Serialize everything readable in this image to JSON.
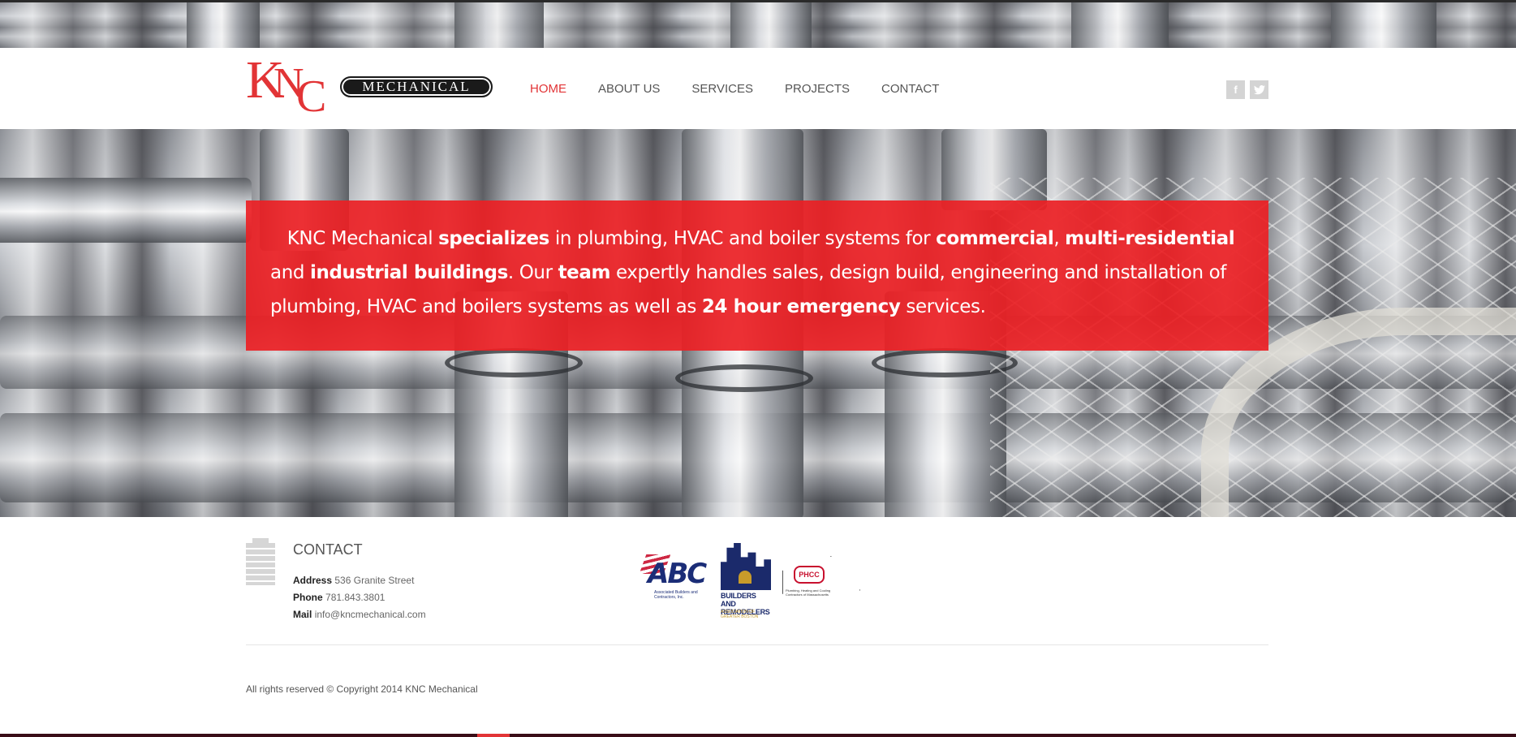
{
  "brand": {
    "logo_letters": [
      "K",
      "N",
      "C"
    ],
    "logo_word": "MECHANICAL",
    "accent_color": "#e23436"
  },
  "nav": {
    "items": [
      {
        "label": "HOME",
        "active": true
      },
      {
        "label": "ABOUT US",
        "active": false
      },
      {
        "label": "SERVICES",
        "active": false
      },
      {
        "label": "PROJECTS",
        "active": false
      },
      {
        "label": "CONTACT",
        "active": false
      }
    ]
  },
  "social": {
    "facebook": "f",
    "twitter": "t",
    "icons": [
      "facebook-icon",
      "twitter-icon"
    ]
  },
  "banner": {
    "segments": [
      {
        "text": "KNC Mechanical ",
        "bold": false
      },
      {
        "text": "specializes",
        "bold": true
      },
      {
        "text": " in plumbing, HVAC and boiler systems for ",
        "bold": false
      },
      {
        "text": "commercial",
        "bold": true
      },
      {
        "text": ", ",
        "bold": false
      },
      {
        "text": "multi-residential",
        "bold": true
      },
      {
        "text": " and ",
        "bold": false
      },
      {
        "text": "industrial buildings",
        "bold": true
      },
      {
        "text": ". Our ",
        "bold": false
      },
      {
        "text": "team",
        "bold": true
      },
      {
        "text": " expertly handles sales, design build, engineering and installation of plumbing, HVAC and boilers systems as well as ",
        "bold": false
      },
      {
        "text": "24 hour emergency",
        "bold": true
      },
      {
        "text": " services.",
        "bold": false
      }
    ]
  },
  "contact": {
    "title": "CONTACT",
    "address_label": "Address",
    "address": "536 Granite Street",
    "phone_label": "Phone",
    "phone": "781.843.3801",
    "mail_label": "Mail",
    "mail": "info@kncmechanical.com"
  },
  "associations": {
    "abc": {
      "mark": "ABC",
      "sub": "Associated Builders and Contractors, Inc."
    },
    "bra": {
      "line1": "BUILDERS AND",
      "line2": "REMODELERS",
      "line3": "ASSOCIATION OF GREATER BOSTON"
    },
    "phcc": {
      "mark": "PHCC",
      "sub": "Plumbing, Heating and Cooling Contractors of Massachusetts"
    }
  },
  "footer": {
    "copyright": "All rights reserved © Copyright 2014 KNC Mechanical"
  }
}
